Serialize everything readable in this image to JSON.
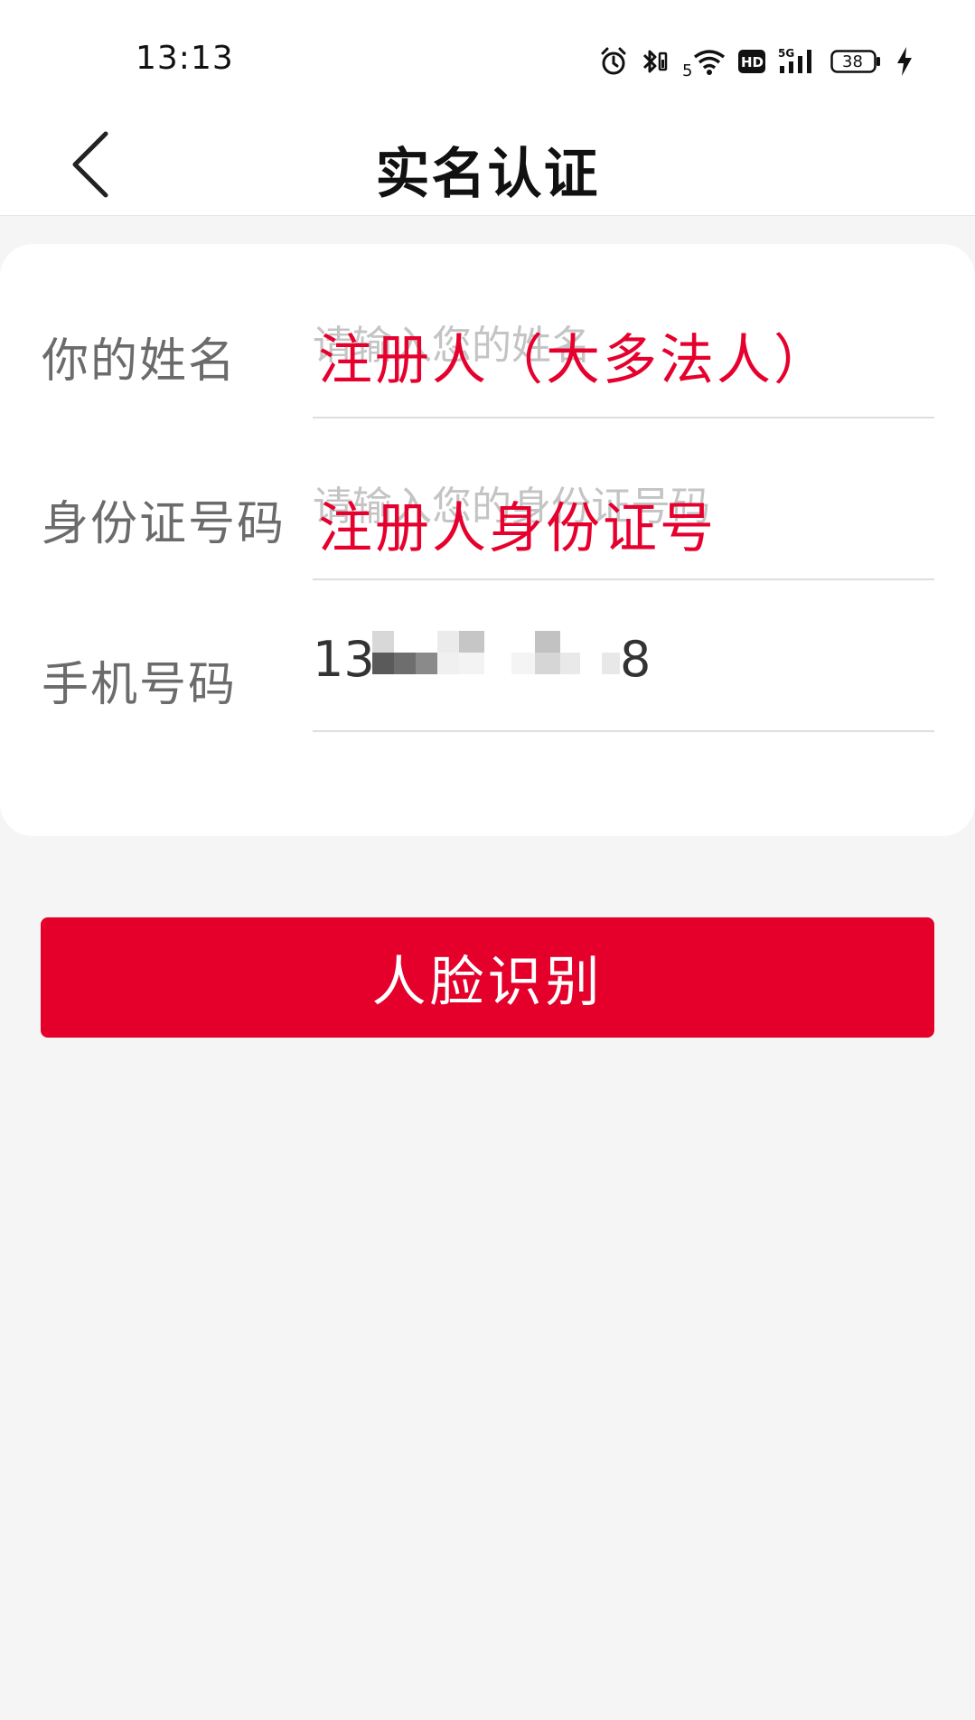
{
  "status_bar": {
    "time": "13:13",
    "battery_level": "38",
    "network": "5G",
    "wifi_badge": "5",
    "hd_badge": "HD",
    "icons": [
      "alarm-icon",
      "bluetooth-icon",
      "wifi-icon",
      "hd-icon",
      "signal-5g-icon",
      "battery-icon",
      "charging-icon"
    ]
  },
  "header": {
    "title": "实名认证",
    "back_icon": "chevron-left-icon"
  },
  "form": {
    "name": {
      "label": "你的姓名",
      "placeholder": "请输入您的姓名",
      "annotation": "注册人（大多法人）"
    },
    "id_number": {
      "label": "身份证号码",
      "placeholder": "请输入您的身份证号码",
      "annotation": "注册人身份证号"
    },
    "phone": {
      "label": "手机号码",
      "value_prefix": "13",
      "value_suffix": "8"
    }
  },
  "actions": {
    "face_recognition_label": "人脸识别"
  },
  "colors": {
    "accent": "#e4002b",
    "annotation": "#e6002d",
    "background": "#f5f5f5",
    "label": "#6b6b6b"
  }
}
